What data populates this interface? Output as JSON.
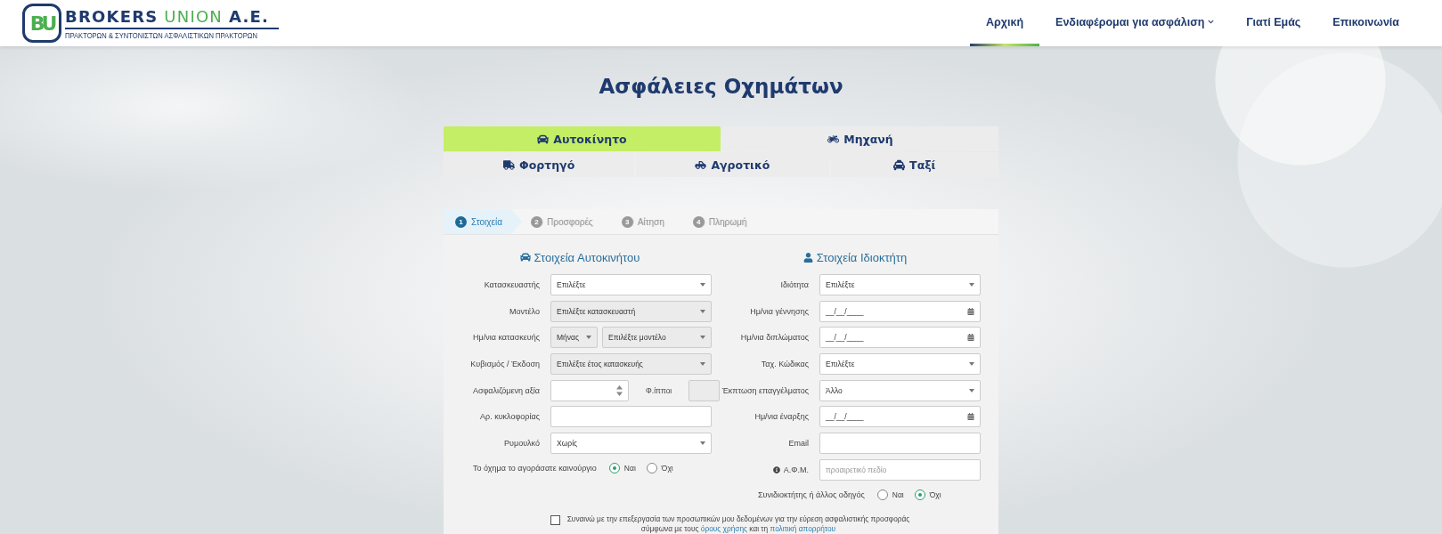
{
  "header": {
    "logo": {
      "monogram": "BU",
      "brand": "BROKERS",
      "brand_accent": "UNION",
      "suffix": "A.E.",
      "tagline": "ΠΡΑΚΤΟΡΩΝ & ΣΥΝΤΟΝΙΣΤΩΝ ΑΣΦΑΛΙΣΤΙΚΩΝ ΠΡΑΚΤΟΡΩΝ"
    },
    "nav": [
      {
        "label": "Αρχική",
        "selected": true,
        "dropdown": false
      },
      {
        "label": "Ενδιαφέρομαι για ασφάλιση",
        "selected": false,
        "dropdown": true
      },
      {
        "label": "Γιατί Εμάς",
        "selected": false,
        "dropdown": false
      },
      {
        "label": "Επικοινωνία",
        "selected": false,
        "dropdown": false
      }
    ]
  },
  "page_title": "Ασφάλειες Οχημάτων",
  "vehicle_tabs": [
    [
      {
        "label": "Αυτοκίνητο",
        "selected": true
      },
      {
        "label": "Μηχανή",
        "selected": false
      }
    ],
    [
      {
        "label": "Φορτηγό",
        "selected": false
      },
      {
        "label": "Αγροτικό",
        "selected": false
      },
      {
        "label": "Ταξί",
        "selected": false
      }
    ]
  ],
  "steps": [
    {
      "number": "1",
      "label": "Στοιχεία",
      "selected": true
    },
    {
      "number": "2",
      "label": "Προσφορές",
      "selected": false
    },
    {
      "number": "3",
      "label": "Αίτηση",
      "selected": false
    },
    {
      "number": "4",
      "label": "Πληρωμή",
      "selected": false
    }
  ],
  "sections": [
    {
      "title": "Στοιχεία Αυτοκινήτου",
      "rows": [
        {
          "kind": "single",
          "label": "Κατασκευαστής",
          "controls": [
            {
              "kind": "select",
              "value": "Επιλέξτε",
              "disabled": false
            }
          ]
        },
        {
          "kind": "single",
          "label": "Μοντέλο",
          "controls": [
            {
              "kind": "select",
              "value": "Επιλέξτε κατασκευαστή",
              "disabled": true
            }
          ]
        },
        {
          "kind": "pair",
          "label": "Ημ/νια κατασκευής",
          "controls": [
            {
              "kind": "select",
              "value": "Μήνας",
              "disabled": true
            },
            {
              "kind": "select",
              "value": "Επιλέξτε μοντέλο",
              "disabled": true
            }
          ]
        },
        {
          "kind": "single",
          "label": "Κυβισμός / Έκδοση",
          "controls": [
            {
              "kind": "select",
              "value": "Επιλέξτε έτος κατασκευής",
              "disabled": true
            }
          ]
        },
        {
          "kind": "value_power",
          "label": "Ασφαλιζόμενη αξία",
          "caption": "Φ.ίπποι",
          "controls": [
            {
              "kind": "number",
              "disabled": false
            },
            {
              "kind": "text",
              "disabled": true
            }
          ]
        },
        {
          "kind": "single",
          "label": "Αρ. κυκλοφορίας",
          "controls": [
            {
              "kind": "text",
              "disabled": false
            }
          ]
        },
        {
          "kind": "single",
          "label": "Ρυμουλκό",
          "controls": [
            {
              "kind": "select",
              "value": "Χωρίς",
              "disabled": false
            }
          ]
        },
        {
          "kind": "radio",
          "label": "Το όχημα το αγοράσατε καινούργιο",
          "options": [
            {
              "label": "Ναι",
              "selected": true
            },
            {
              "label": "Όχι",
              "selected": false
            }
          ]
        }
      ]
    },
    {
      "title": "Στοιχεία Ιδιοκτήτη",
      "rows": [
        {
          "kind": "single",
          "label": "Ιδιότητα",
          "controls": [
            {
              "kind": "select",
              "value": "Επιλέξτε",
              "disabled": false
            }
          ]
        },
        {
          "kind": "single",
          "label": "Ημ/νια γέννησης",
          "controls": [
            {
              "kind": "date",
              "value": "__/__/____",
              "disabled": false
            }
          ]
        },
        {
          "kind": "single",
          "label": "Ημ/νια διπλώματος",
          "controls": [
            {
              "kind": "date",
              "value": "__/__/____",
              "disabled": false
            }
          ]
        },
        {
          "kind": "single",
          "label": "Ταχ. Κώδικας",
          "controls": [
            {
              "kind": "select",
              "value": "Επιλέξτε",
              "disabled": false
            }
          ]
        },
        {
          "kind": "single",
          "label": "Έκπτωση επαγγέλματος",
          "controls": [
            {
              "kind": "select",
              "value": "Άλλο",
              "disabled": false
            }
          ]
        },
        {
          "kind": "single",
          "label": "Ημ/νια έναρξης",
          "controls": [
            {
              "kind": "date",
              "value": "__/__/____",
              "disabled": false
            }
          ]
        },
        {
          "kind": "single",
          "label": "Email",
          "controls": [
            {
              "kind": "text",
              "disabled": false
            }
          ]
        },
        {
          "kind": "single",
          "label": "Α.Φ.Μ.",
          "info": true,
          "controls": [
            {
              "kind": "text",
              "placeholder": "προαιρετικό πεδίο",
              "disabled": false
            }
          ]
        },
        {
          "kind": "radio",
          "label": "Συνιδιοκτήτης ή άλλος οδηγός",
          "options": [
            {
              "label": "Ναι",
              "selected": false
            },
            {
              "label": "Όχι",
              "selected": true
            }
          ]
        }
      ]
    }
  ],
  "consent": {
    "checked": false,
    "text": "Συναινώ με την επεξεργασία των προσωπικών μου δεδομένων για την εύρεση ασφαλιστικής προσφοράς",
    "text_2": "σύμφωνα με τους",
    "link_terms": "όρους χρήσης",
    "joiner": "και τη",
    "link_privacy": "πολιτική απορρήτου"
  }
}
